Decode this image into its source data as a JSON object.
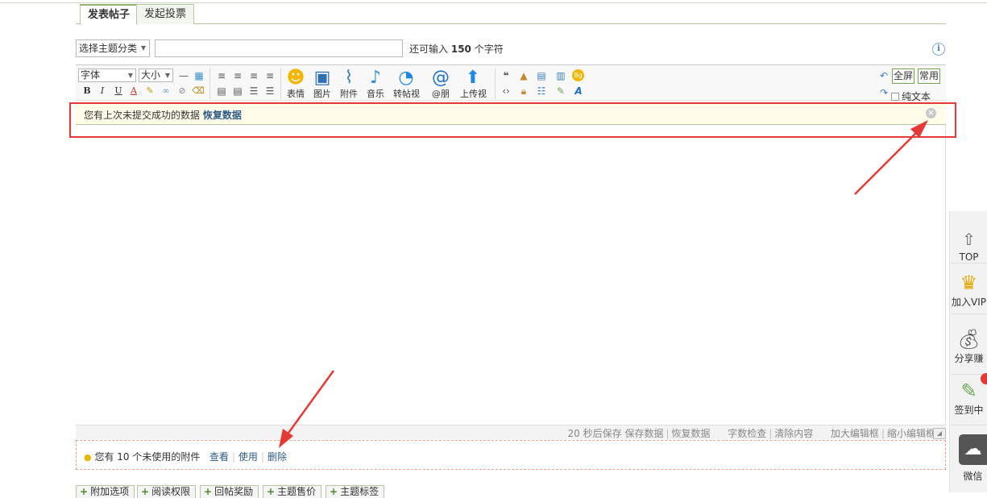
{
  "tabs": {
    "post": "发表帖子",
    "poll": "发起投票"
  },
  "subject": {
    "category_select": "选择主题分类",
    "input_value": "",
    "remain_prefix": "还可输入",
    "remain_count": "150",
    "remain_suffix": "个字符"
  },
  "toolbar": {
    "font_select": "字体",
    "size_select": "大小",
    "bold": "B",
    "italic": "I",
    "underline": "U",
    "color": "A",
    "big_buttons": [
      "表情",
      "图片",
      "附件",
      "音乐",
      "转帖视",
      "@朋",
      "上传视"
    ],
    "fullscreen": "全屏",
    "common": "常用",
    "plain_text": "纯文本"
  },
  "notice": {
    "text": "您有上次未提交成功的数据",
    "restore_link": "恢复数据"
  },
  "statusbar": {
    "autosave": "20 秒后保存",
    "save": "保存数据",
    "restore": "恢复数据",
    "wordcheck": "字数检查",
    "clear": "清除内容",
    "enlarge": "加大编辑框",
    "shrink": "缩小编辑框"
  },
  "attachments": {
    "prefix": "您有",
    "count": "10",
    "suffix": "个未使用的附件",
    "view": "查看",
    "use": "使用",
    "delete": "删除"
  },
  "option_tabs": [
    "附加选项",
    "阅读权限",
    "回帖奖励",
    "主题售价",
    "主题标签"
  ],
  "sidebar": {
    "top": "TOP",
    "vip": "加入VIP",
    "share": "分享赚",
    "signin": "签到中",
    "wechat": "微信"
  },
  "colors": {
    "accent_green": "#8fb36a",
    "highlight_red": "#e53935",
    "link_blue": "#2f5d8a"
  }
}
